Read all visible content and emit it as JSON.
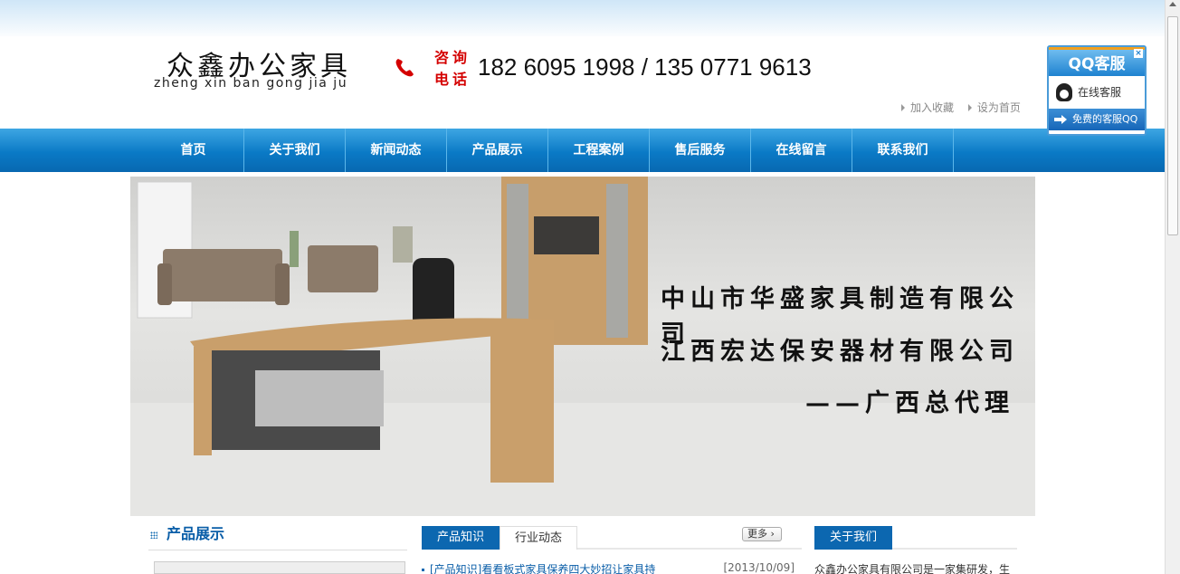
{
  "header": {
    "logo_cn": "众鑫办公家具",
    "logo_pinyin": "zheng xin ban gong jia ju",
    "consult_label": "咨询电话",
    "phone_numbers": "182 6095 1998 / 135 0771 9613",
    "links": [
      "加入收藏",
      "设为首页"
    ]
  },
  "nav": {
    "items": [
      "首页",
      "关于我们",
      "新闻动态",
      "产品展示",
      "工程案例",
      "售后服务",
      "在线留言",
      "联系我们"
    ]
  },
  "banner": {
    "line1": "中山市华盛家具制造有限公司",
    "line2": "江西宏达保安器材有限公司",
    "line3": "——广西总代理"
  },
  "products": {
    "title": "产品展示"
  },
  "news": {
    "tabs": [
      "产品知识",
      "行业动态"
    ],
    "more_label": "更多",
    "items": [
      {
        "title": "[产品知识]看看板式家具保养四大妙招让家具持",
        "date": "[2013/10/09]"
      }
    ]
  },
  "about": {
    "title": "关于我们",
    "text": "众鑫办公家具有限公司是一家集研发，生"
  },
  "qq_widget": {
    "title": "QQ客服",
    "online_label": "在线客服",
    "footer_label": "免费的客服QQ",
    "close": "×"
  },
  "colors": {
    "nav_blue": "#0a7ac6",
    "accent_blue": "#0c67b0",
    "consult_red": "#d40000"
  }
}
